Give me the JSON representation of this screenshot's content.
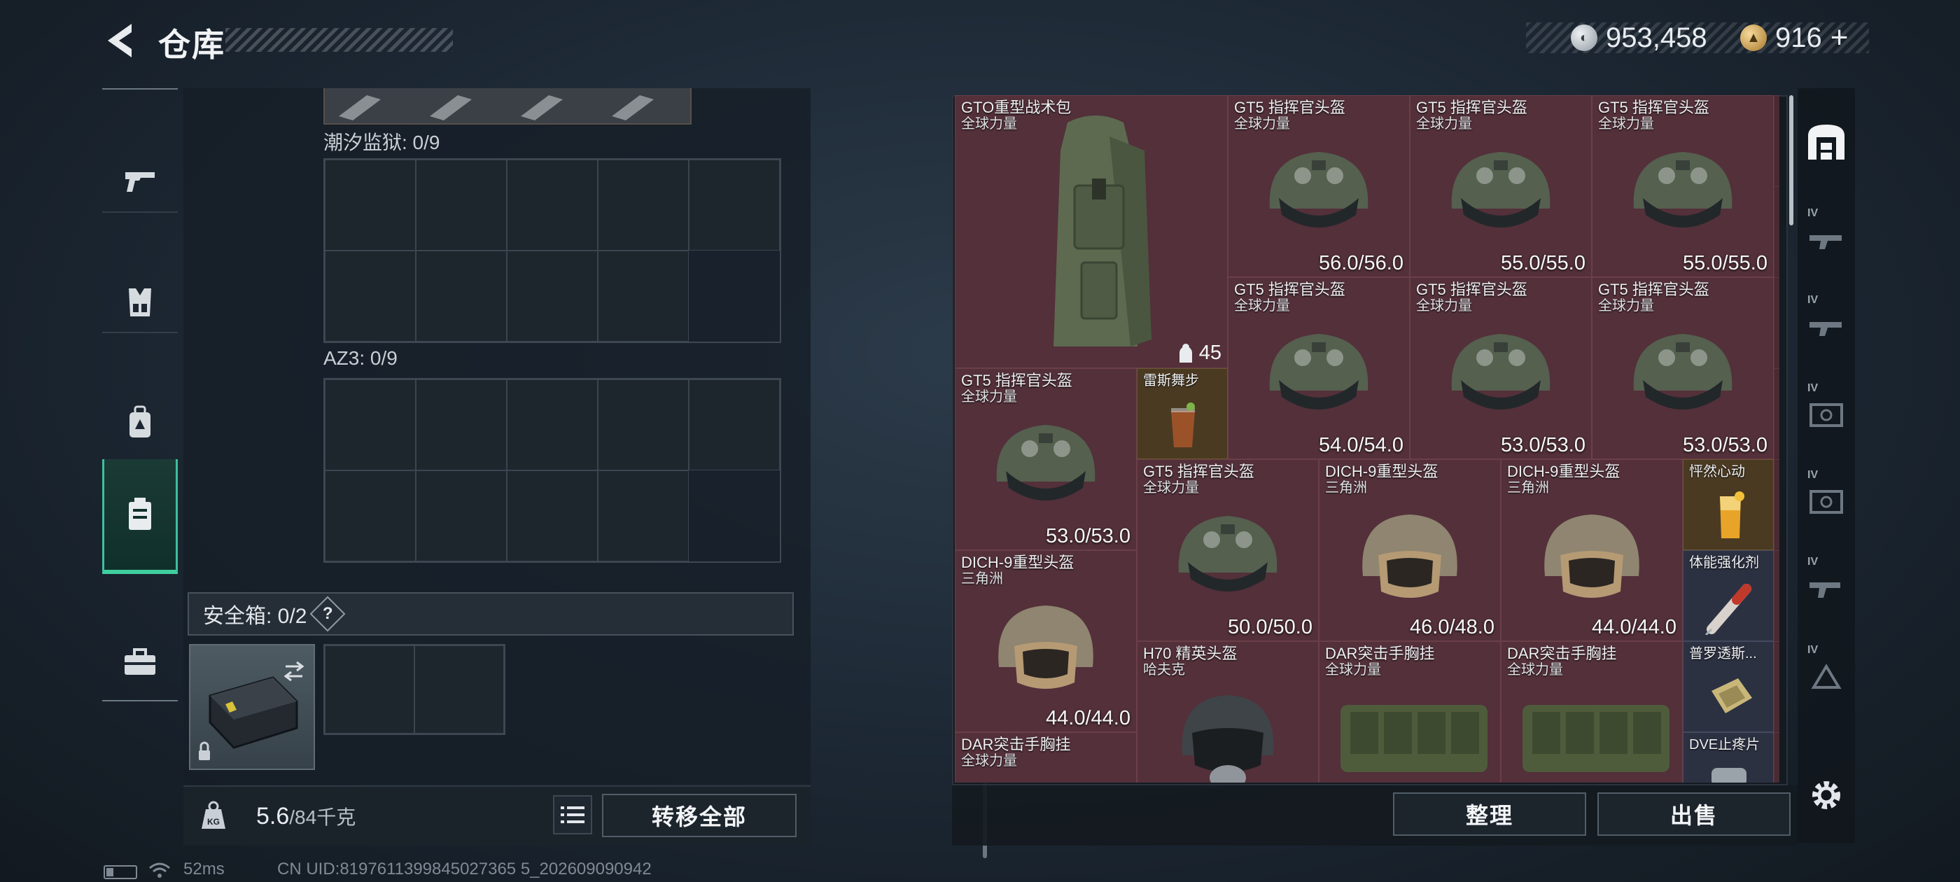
{
  "header": {
    "title": "仓库"
  },
  "currency": {
    "silver": "953,458",
    "gold": "916",
    "gold_plus": "+"
  },
  "left": {
    "sections": [
      {
        "label": "潮汐监狱: 0/9"
      },
      {
        "label": "AZ3: 0/9"
      }
    ],
    "safe_box_label": "安全箱: 0/2",
    "safe_help": "?",
    "weight_current": "5.6",
    "weight_max": "/84千克",
    "transfer_all": "转移全部"
  },
  "stash": {
    "items": [
      {
        "name": "GTO重型战术包",
        "sub": "全球力量",
        "count": "45",
        "kind": "backpack"
      },
      {
        "name": "GT5 指挥官头盔",
        "sub": "全球力量",
        "value": "56.0/56.0",
        "kind": "helmet-gt5"
      },
      {
        "name": "GT5 指挥官头盔",
        "sub": "全球力量",
        "value": "55.0/55.0",
        "kind": "helmet-gt5"
      },
      {
        "name": "GT5 指挥官头盔",
        "sub": "全球力量",
        "value": "55.0/55.0",
        "kind": "helmet-gt5"
      },
      {
        "name": "GT5 指挥官头盔",
        "sub": "全球力量",
        "value": "54.0/54.0",
        "kind": "helmet-gt5"
      },
      {
        "name": "GT5 指挥官头盔",
        "sub": "全球力量",
        "value": "53.0/53.0",
        "kind": "helmet-gt5"
      },
      {
        "name": "GT5 指挥官头盔",
        "sub": "全球力量",
        "value": "53.0/53.0",
        "kind": "helmet-gt5"
      },
      {
        "name": "GT5 指挥官头盔",
        "sub": "全球力量",
        "value": "53.0/53.0",
        "kind": "helmet-gt5"
      },
      {
        "name": "雷斯舞步",
        "sub": "",
        "kind": "drink"
      },
      {
        "name": "GT5 指挥官头盔",
        "sub": "全球力量",
        "value": "50.0/50.0",
        "kind": "helmet-gt5"
      },
      {
        "name": "DICH-9重型头盔",
        "sub": "三角洲",
        "value": "46.0/48.0",
        "kind": "helmet-dich"
      },
      {
        "name": "DICH-9重型头盔",
        "sub": "三角洲",
        "value": "44.0/44.0",
        "kind": "helmet-dich"
      },
      {
        "name": "怦然心动",
        "sub": "",
        "kind": "drink"
      },
      {
        "name": "DICH-9重型头盔",
        "sub": "三角洲",
        "value": "44.0/44.0",
        "kind": "helmet-dich"
      },
      {
        "name": "体能强化剂",
        "sub": "",
        "kind": "syringe"
      },
      {
        "name": "H70 精英头盔",
        "sub": "哈夫克",
        "kind": "helmet-h70"
      },
      {
        "name": "DAR突击手胸挂",
        "sub": "全球力量",
        "kind": "vest"
      },
      {
        "name": "DAR突击手胸挂",
        "sub": "全球力量",
        "kind": "vest"
      },
      {
        "name": "普罗透斯...",
        "sub": "",
        "kind": "pack"
      },
      {
        "name": "DAR突击手胸挂",
        "sub": "全球力量",
        "kind": "vest"
      },
      {
        "name": "DVE止疼片",
        "sub": "",
        "kind": "pills"
      }
    ],
    "sort": "整理",
    "sell": "出售"
  },
  "right_sidebar": {
    "tiers": [
      "IV",
      "IV",
      "IV",
      "IV",
      "IV",
      "IV"
    ]
  },
  "status": {
    "ping": "52ms",
    "uid": "CN UID:8197611399845027365 5_202609090942"
  }
}
